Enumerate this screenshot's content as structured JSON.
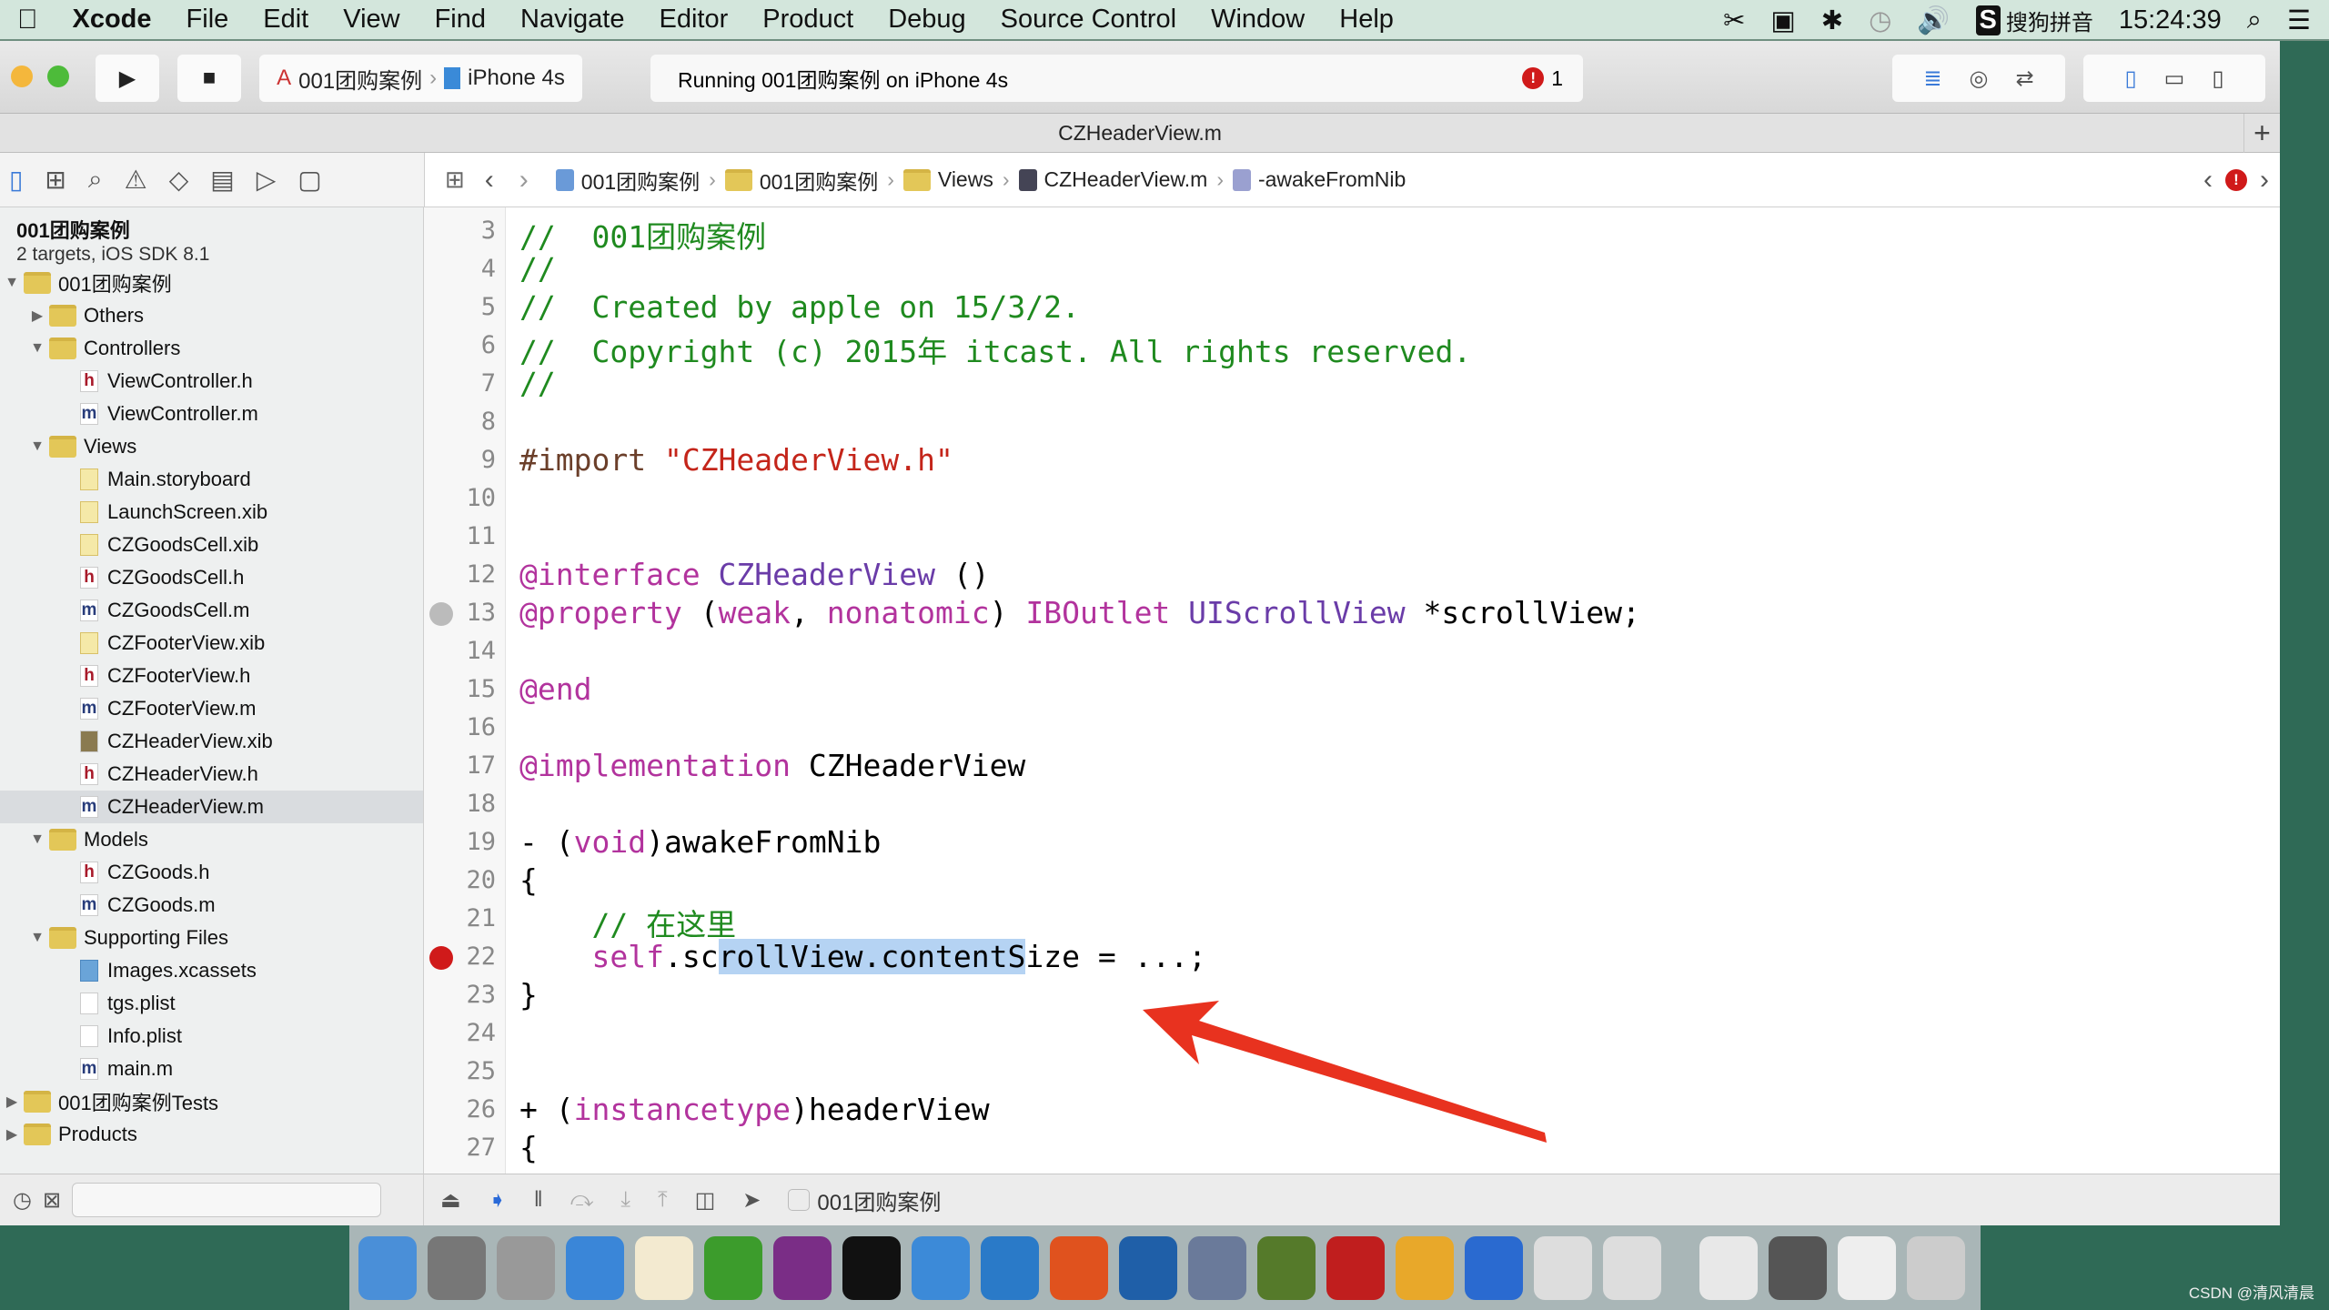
{
  "menubar": {
    "items": [
      "Xcode",
      "File",
      "Edit",
      "View",
      "Find",
      "Navigate",
      "Editor",
      "Product",
      "Debug",
      "Source Control",
      "Window",
      "Help"
    ],
    "input_method": "搜狗拼音",
    "clock": "15:24:39"
  },
  "toolbar": {
    "scheme": "001团购案例",
    "device": "iPhone 4s",
    "status": "Running 001团购案例 on iPhone 4s",
    "error_count": "1"
  },
  "tab": {
    "title": "CZHeaderView.m"
  },
  "jumpbar": [
    "001团购案例",
    "001团购案例",
    "Views",
    "CZHeaderView.m",
    "-awakeFromNib"
  ],
  "project": {
    "name": "001团购案例",
    "subtitle": "2 targets, iOS SDK 8.1"
  },
  "tree": [
    {
      "label": "001团购案例",
      "type": "folder",
      "level": 0,
      "open": true
    },
    {
      "label": "Others",
      "type": "folder",
      "level": 1,
      "open": false
    },
    {
      "label": "Controllers",
      "type": "folder",
      "level": 1,
      "open": true
    },
    {
      "label": "ViewController.h",
      "type": "h",
      "level": 2
    },
    {
      "label": "ViewController.m",
      "type": "m",
      "level": 2
    },
    {
      "label": "Views",
      "type": "folder",
      "level": 1,
      "open": true
    },
    {
      "label": "Main.storyboard",
      "type": "sb",
      "level": 2
    },
    {
      "label": "LaunchScreen.xib",
      "type": "xib",
      "level": 2
    },
    {
      "label": "CZGoodsCell.xib",
      "type": "xib",
      "level": 2
    },
    {
      "label": "CZGoodsCell.h",
      "type": "h",
      "level": 2
    },
    {
      "label": "CZGoodsCell.m",
      "type": "m",
      "level": 2
    },
    {
      "label": "CZFooterView.xib",
      "type": "xib",
      "level": 2
    },
    {
      "label": "CZFooterView.h",
      "type": "h",
      "level": 2
    },
    {
      "label": "CZFooterView.m",
      "type": "m",
      "level": 2
    },
    {
      "label": "CZHeaderView.xib",
      "type": "xibdark",
      "level": 2
    },
    {
      "label": "CZHeaderView.h",
      "type": "h",
      "level": 2
    },
    {
      "label": "CZHeaderView.m",
      "type": "m",
      "level": 2,
      "selected": true
    },
    {
      "label": "Models",
      "type": "folder",
      "level": 1,
      "open": true
    },
    {
      "label": "CZGoods.h",
      "type": "h",
      "level": 2
    },
    {
      "label": "CZGoods.m",
      "type": "m",
      "level": 2
    },
    {
      "label": "Supporting Files",
      "type": "folder",
      "level": 1,
      "open": true
    },
    {
      "label": "Images.xcassets",
      "type": "assets",
      "level": 2
    },
    {
      "label": "tgs.plist",
      "type": "plist",
      "level": 2
    },
    {
      "label": "Info.plist",
      "type": "plist",
      "level": 2
    },
    {
      "label": "main.m",
      "type": "m",
      "level": 2
    },
    {
      "label": "001团购案例Tests",
      "type": "folder",
      "level": 0,
      "open": false
    },
    {
      "label": "Products",
      "type": "folder",
      "level": 0,
      "open": false
    }
  ],
  "code": [
    {
      "n": "3",
      "tokens": [
        [
          "//  001团购案例",
          "comment"
        ]
      ]
    },
    {
      "n": "4",
      "tokens": [
        [
          "//",
          "comment"
        ]
      ]
    },
    {
      "n": "5",
      "tokens": [
        [
          "//  Created by apple on 15/3/2.",
          "comment"
        ]
      ]
    },
    {
      "n": "6",
      "tokens": [
        [
          "//  Copyright (c) 2015年 itcast. All rights reserved.",
          "comment"
        ]
      ]
    },
    {
      "n": "7",
      "tokens": [
        [
          "//",
          "comment"
        ]
      ]
    },
    {
      "n": "8",
      "tokens": []
    },
    {
      "n": "9",
      "tokens": [
        [
          "#import ",
          "pre"
        ],
        [
          "\"CZHeaderView.h\"",
          "str"
        ]
      ]
    },
    {
      "n": "10",
      "tokens": []
    },
    {
      "n": "11",
      "tokens": []
    },
    {
      "n": "12",
      "tokens": [
        [
          "@interface ",
          "kw"
        ],
        [
          "CZHeaderView",
          "cls"
        ],
        [
          " ()",
          "plain"
        ]
      ]
    },
    {
      "n": "13",
      "marker": "outlet",
      "tokens": [
        [
          "@property ",
          "kw"
        ],
        [
          "(",
          "plain"
        ],
        [
          "weak",
          "kw"
        ],
        [
          ", ",
          "plain"
        ],
        [
          "nonatomic",
          "kw"
        ],
        [
          ") ",
          "plain"
        ],
        [
          "IBOutlet ",
          "kw"
        ],
        [
          "UIScrollView ",
          "cls"
        ],
        [
          "*scrollView;",
          "plain"
        ]
      ]
    },
    {
      "n": "14",
      "tokens": []
    },
    {
      "n": "15",
      "tokens": [
        [
          "@end",
          "kw"
        ]
      ]
    },
    {
      "n": "16",
      "tokens": []
    },
    {
      "n": "17",
      "tokens": [
        [
          "@implementation ",
          "kw"
        ],
        [
          "CZHeaderView",
          "plain"
        ]
      ]
    },
    {
      "n": "18",
      "tokens": []
    },
    {
      "n": "19",
      "tokens": [
        [
          "- (",
          "plain"
        ],
        [
          "void",
          "kw"
        ],
        [
          ")awakeFromNib",
          "plain"
        ]
      ]
    },
    {
      "n": "20",
      "tokens": [
        [
          "{",
          "plain"
        ]
      ]
    },
    {
      "n": "21",
      "tokens": [
        [
          "    // 在这里",
          "comment"
        ]
      ]
    },
    {
      "n": "22",
      "marker": "error",
      "tokens": [
        [
          "    ",
          "plain"
        ],
        [
          "self",
          "kw"
        ],
        [
          ".sc",
          "plain"
        ],
        [
          "rollView.contentS",
          "sel"
        ],
        [
          "ize = ...;",
          "plain"
        ]
      ]
    },
    {
      "n": "23",
      "tokens": [
        [
          "}",
          "plain"
        ]
      ]
    },
    {
      "n": "24",
      "tokens": []
    },
    {
      "n": "25",
      "tokens": []
    },
    {
      "n": "26",
      "tokens": [
        [
          "+ (",
          "plain"
        ],
        [
          "instancetype",
          "kw"
        ],
        [
          ")headerView",
          "plain"
        ]
      ]
    },
    {
      "n": "27",
      "tokens": [
        [
          "{",
          "plain"
        ]
      ]
    }
  ],
  "debugbar": {
    "target": "001团购案例"
  },
  "dock": [
    {
      "name": "Finder",
      "color": "#4a8fd8"
    },
    {
      "name": "System Preferences",
      "color": "#777"
    },
    {
      "name": "Launchpad",
      "color": "#999"
    },
    {
      "name": "Safari",
      "color": "#3a86d8"
    },
    {
      "name": "Notes",
      "color": "#f3ead0"
    },
    {
      "name": "Xmind",
      "color": "#3c9c2c"
    },
    {
      "name": "OneNote",
      "color": "#7a2d86"
    },
    {
      "name": "Terminal",
      "color": "#111"
    },
    {
      "name": "Xcode",
      "color": "#3c8ad8"
    },
    {
      "name": "Keynote",
      "color": "#2a7ac8"
    },
    {
      "name": "PowerPoint",
      "color": "#e0521e"
    },
    {
      "name": "Snip",
      "color": "#1f5fa8"
    },
    {
      "name": "Photo Booth",
      "color": "#6a7a9a"
    },
    {
      "name": "Instruments",
      "color": "#557a2a"
    },
    {
      "name": "FileZilla",
      "color": "#c01e1e"
    },
    {
      "name": "Sketch",
      "color": "#e8a82a"
    },
    {
      "name": "Word",
      "color": "#2a6ad0"
    },
    {
      "name": "Text Editor",
      "color": "#ddd"
    },
    {
      "name": "Text Editor 2",
      "color": "#ddd"
    },
    {
      "name": "Preview",
      "color": "#e8e8e8"
    },
    {
      "name": "Screen Sharing",
      "color": "#555"
    },
    {
      "name": "Downloads",
      "color": "#eee"
    },
    {
      "name": "Trash",
      "color": "#ccc"
    }
  ],
  "watermark": "CSDN @清风清晨",
  "colors": {
    "annotation_arrow": "#e8321f",
    "error": "#d01a1a",
    "selection": "#b5d3f3"
  }
}
